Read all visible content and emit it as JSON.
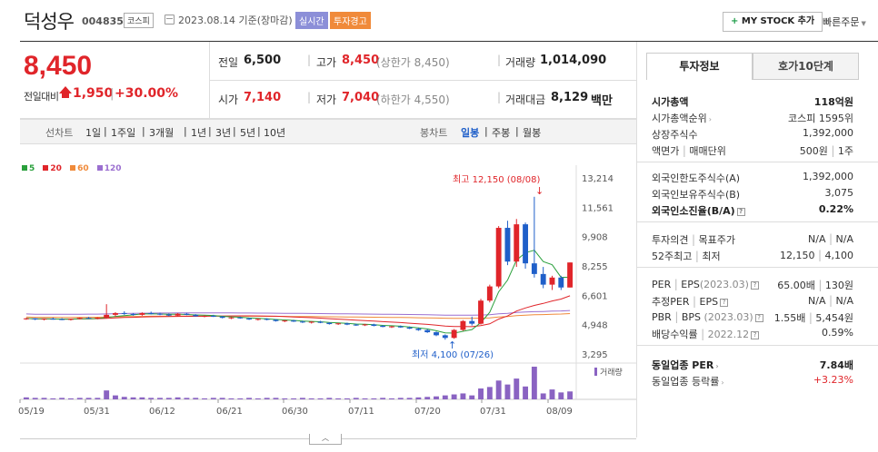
{
  "header": {
    "stock_name": "덕성우",
    "stock_code": "004835",
    "market": "코스피",
    "date_text": "2023.08.14 기준(장마감)",
    "tag_live": "실시간",
    "tag_warning": "투자경고",
    "mystock_label": "MY STOCK 추가",
    "mystock_plus": "+",
    "quick_order_label": "빠른주문"
  },
  "price": {
    "current": "8,450",
    "change_label": "전일대비",
    "change_value": "1,950",
    "change_sep": "|",
    "change_pct": "+30.00%"
  },
  "quote": {
    "prev_label": "전일",
    "prev_value": "6,500",
    "high_label": "고가",
    "high_value": "8,450",
    "high_sub": "(상한가 8,450)",
    "volume_label": "거래량",
    "volume_value": "1,014,090",
    "open_label": "시가",
    "open_value": "7,140",
    "low_label": "저가",
    "low_value": "7,040",
    "low_sub": "(하한가 4,550)",
    "amount_label": "거래대금",
    "amount_value": "8,129",
    "amount_unit": "백만"
  },
  "period_bar": {
    "line_label": "선차트",
    "periods": [
      "1일",
      "1주일",
      "3개월",
      "1년",
      "3년",
      "5년",
      "10년"
    ],
    "candle_label": "봉차트",
    "candle_types": [
      "일봉",
      "주봉",
      "월봉"
    ],
    "active_candle": "일봉"
  },
  "legend": [
    {
      "label": "5",
      "color": "#2aa03c"
    },
    {
      "label": "20",
      "color": "#e0252a"
    },
    {
      "label": "60",
      "color": "#f08a3a"
    },
    {
      "label": "120",
      "color": "#9b6fd0"
    }
  ],
  "chart_data": {
    "type": "candlestick",
    "yticks": [
      "13,214",
      "11,561",
      "9,908",
      "8,255",
      "6,601",
      "4,948",
      "3,295"
    ],
    "yrange": [
      3295,
      13214
    ],
    "xticks": [
      "05/19",
      "05/31",
      "06/12",
      "06/21",
      "06/30",
      "07/11",
      "07/20",
      "07/31",
      "08/09"
    ],
    "max_annotation": "최고 12,150 (08/08)",
    "min_annotation": "최저 4,100 (07/26)",
    "volume_label": "거래량",
    "up_color": "#e0252a",
    "down_color": "#1f5fc9",
    "candles": [
      [
        5270,
        5330,
        5220,
        5300
      ],
      [
        5300,
        5320,
        5200,
        5240
      ],
      [
        5240,
        5300,
        5190,
        5280
      ],
      [
        5280,
        5340,
        5230,
        5260
      ],
      [
        5260,
        5310,
        5200,
        5220
      ],
      [
        5220,
        5290,
        5180,
        5270
      ],
      [
        5270,
        5350,
        5240,
        5330
      ],
      [
        5330,
        5380,
        5280,
        5300
      ],
      [
        5300,
        5360,
        5250,
        5340
      ],
      [
        5340,
        6100,
        5300,
        5500
      ],
      [
        5500,
        5650,
        5400,
        5600
      ],
      [
        5600,
        5700,
        5500,
        5550
      ],
      [
        5550,
        5600,
        5450,
        5500
      ],
      [
        5500,
        5640,
        5450,
        5600
      ],
      [
        5600,
        5680,
        5520,
        5560
      ],
      [
        5560,
        5620,
        5480,
        5520
      ],
      [
        5520,
        5580,
        5420,
        5460
      ],
      [
        5460,
        5600,
        5420,
        5560
      ],
      [
        5560,
        5610,
        5480,
        5500
      ],
      [
        5500,
        5540,
        5400,
        5420
      ],
      [
        5420,
        5480,
        5360,
        5440
      ],
      [
        5440,
        5500,
        5380,
        5400
      ],
      [
        5400,
        5440,
        5300,
        5330
      ],
      [
        5330,
        5380,
        5260,
        5350
      ],
      [
        5350,
        5400,
        5280,
        5300
      ],
      [
        5300,
        5340,
        5210,
        5240
      ],
      [
        5240,
        5300,
        5180,
        5270
      ],
      [
        5270,
        5310,
        5190,
        5220
      ],
      [
        5220,
        5260,
        5120,
        5150
      ],
      [
        5150,
        5200,
        5090,
        5180
      ],
      [
        5180,
        5220,
        5100,
        5120
      ],
      [
        5120,
        5170,
        5040,
        5080
      ],
      [
        5080,
        5140,
        5010,
        5110
      ],
      [
        5110,
        5160,
        5030,
        5050
      ],
      [
        5050,
        5080,
        4950,
        4980
      ],
      [
        4980,
        5050,
        4930,
        5020
      ],
      [
        5020,
        5060,
        4920,
        4950
      ],
      [
        4950,
        5000,
        4880,
        4920
      ],
      [
        4920,
        4990,
        4870,
        4960
      ],
      [
        4960,
        5000,
        4850,
        4880
      ],
      [
        4880,
        4930,
        4800,
        4820
      ],
      [
        4820,
        4880,
        4760,
        4850
      ],
      [
        4850,
        4900,
        4770,
        4790
      ],
      [
        4790,
        4840,
        4700,
        4720
      ],
      [
        4720,
        4780,
        4600,
        4640
      ],
      [
        4640,
        4700,
        4480,
        4520
      ],
      [
        4520,
        4560,
        4300,
        4350
      ],
      [
        4350,
        4400,
        4100,
        4200
      ],
      [
        4200,
        4700,
        4150,
        4650
      ],
      [
        4650,
        5200,
        4600,
        5150
      ],
      [
        5150,
        5400,
        4900,
        5000
      ],
      [
        5000,
        6400,
        4950,
        6300
      ],
      [
        6300,
        7200,
        6200,
        7100
      ],
      [
        7100,
        10500,
        7000,
        10400
      ],
      [
        10400,
        10800,
        8300,
        8500
      ],
      [
        8500,
        10900,
        8200,
        10600
      ],
      [
        10600,
        10700,
        8100,
        8400
      ],
      [
        8400,
        12150,
        7600,
        7800
      ],
      [
        7800,
        8200,
        7000,
        7200
      ],
      [
        7200,
        7700,
        6900,
        7600
      ],
      [
        7600,
        7700,
        6900,
        7040
      ],
      [
        7040,
        8450,
        7040,
        8450
      ]
    ],
    "volumes": [
      4,
      3,
      3,
      2,
      3,
      2,
      3,
      3,
      3,
      18,
      8,
      5,
      4,
      4,
      3,
      3,
      3,
      4,
      3,
      3,
      2,
      3,
      3,
      2,
      2,
      3,
      2,
      3,
      3,
      2,
      2,
      3,
      2,
      2,
      3,
      2,
      2,
      3,
      2,
      2,
      3,
      2,
      3,
      3,
      4,
      5,
      6,
      8,
      10,
      12,
      8,
      22,
      25,
      38,
      30,
      42,
      26,
      66,
      12,
      20,
      14,
      16
    ]
  },
  "side_panel": {
    "tab_active": "투자정보",
    "tab_inactive": "호가10단계",
    "market_cap_label": "시가총액",
    "market_cap_value": "118억원",
    "cap_rank_label": "시가총액순위",
    "cap_rank_value": "코스피 1595위",
    "shares_label": "상장주식수",
    "shares_value": "1,392,000",
    "par_label": "액면가",
    "par_sep": "|",
    "unit_label": "매매단위",
    "par_value": "500원",
    "unit_value": "1주",
    "foreign_limit_label": "외국인한도주식수(A)",
    "foreign_limit_value": "1,392,000",
    "foreign_hold_label": "외국인보유주식수(B)",
    "foreign_hold_value": "3,075",
    "foreign_ratio_label": "외국인소진율(B/A)",
    "foreign_ratio_value": "0.22%",
    "opinion_label": "투자의견",
    "target_label": "목표주가",
    "opinion_value": "N/A",
    "target_value": "N/A",
    "week52_label": "52주최고",
    "week52_low_label": "최저",
    "week52_high": "12,150",
    "week52_low": "4,100",
    "per_label": "PER",
    "eps_label": "EPS",
    "per_date": "(2023.03)",
    "per_value": "65.00배",
    "eps_value": "130원",
    "est_per_label": "추정PER",
    "est_eps_label": "EPS",
    "est_per_value": "N/A",
    "est_eps_value": "N/A",
    "pbr_label": "PBR",
    "bps_label": "BPS",
    "pbr_date": "(2023.03)",
    "pbr_value": "1.55배",
    "bps_value": "5,454원",
    "dividend_label": "배당수익률",
    "dividend_date": "2022.12",
    "dividend_value": "0.59%",
    "sector_per_label": "동일업종 PER",
    "sector_per_value": "7.84배",
    "sector_rate_label": "동일업종 등락률",
    "sector_rate_value": "+3.23%"
  }
}
